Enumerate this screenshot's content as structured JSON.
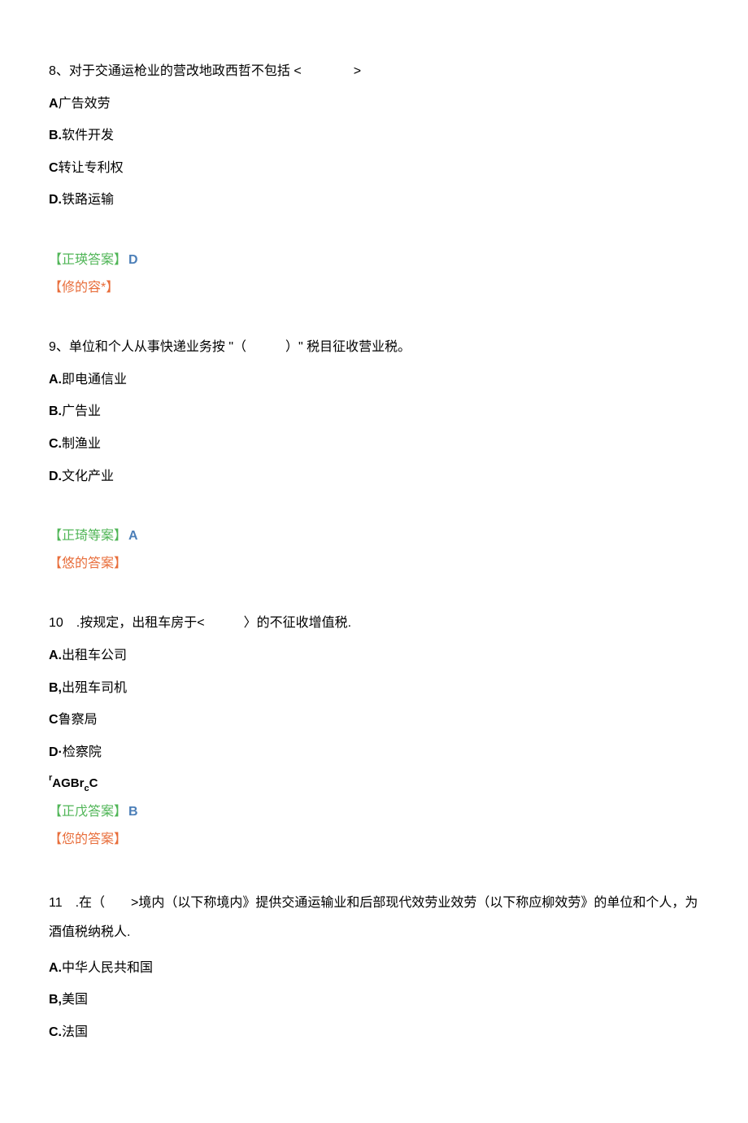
{
  "q8": {
    "question": "8、对于交通运枪业的营改地政西哲不包括 <　　　　>",
    "options": {
      "a": {
        "label": "A",
        "text": "广告效劳"
      },
      "b": {
        "label": "B.",
        "text": "软件开发"
      },
      "c": {
        "label": "C",
        "text": "转让专利权"
      },
      "d": {
        "label": "D.",
        "text": "铁路运输"
      }
    },
    "ans_correct_label": "【正瑛答案】",
    "ans_correct_letter": "D",
    "ans_your": "【修的容*】"
  },
  "q9": {
    "question": "9、单位和个人从事快递业务按 \"（　　　）\" 税目征收营业税。",
    "options": {
      "a": {
        "label": "A.",
        "text": "即电通信业"
      },
      "b": {
        "label": "B.",
        "text": "广告业"
      },
      "c": {
        "label": "C.",
        "text": "制渔业"
      },
      "d": {
        "label": "D.",
        "text": "文化产业"
      }
    },
    "ans_correct_label": "【正琦等案】",
    "ans_correct_letter": "A",
    "ans_your": "【悠的答案】"
  },
  "q10": {
    "question": "10　.按规定，出租车房于<　　　〉的不征收增值税.",
    "options": {
      "a": {
        "label": "A.",
        "text": "出租车公司"
      },
      "b": {
        "label": "B,",
        "text": "出殂车司机"
      },
      "c": {
        "label": "C",
        "text": "鲁察局"
      },
      "d": {
        "label": "D·",
        "text": "检察院"
      }
    },
    "extra_line": {
      "r": "r",
      "agbr": "AGBr",
      "c_sub": "c",
      "C": "C"
    },
    "ans_correct_label": "【正戊答案】",
    "ans_correct_letter": "B",
    "ans_your": "【您的答案】"
  },
  "q11": {
    "question": "11　.在（　　>境内（以下称境内》提供交通运输业和后部现代效劳业效劳（以下称应柳效劳》的单位和个人，为酒值税纳税人.",
    "options": {
      "a": {
        "label": "A.",
        "text": "中华人民共和国"
      },
      "b": {
        "label": "B,",
        "text": "美国"
      },
      "c": {
        "label": "C.",
        "text": "法国"
      }
    }
  }
}
